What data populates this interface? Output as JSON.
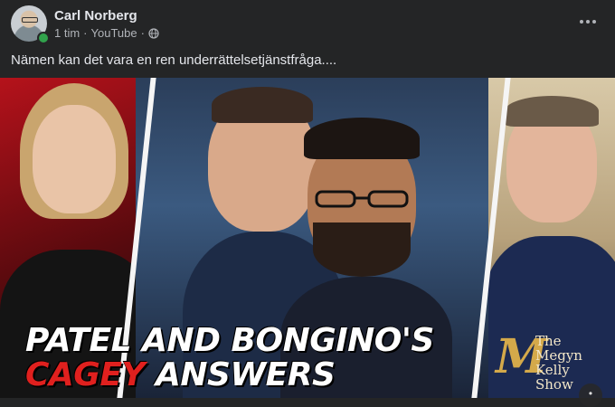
{
  "post": {
    "author": "Carl Norberg",
    "time": "1 tim",
    "separator": "·",
    "source": "YouTube",
    "text": "Nämen kan det vara en ren underrättelsetjänstfråga...."
  },
  "media": {
    "headline_line1": "PATEL AND BONGINO'S",
    "headline_line2_red": "CAGEY",
    "headline_line2_white": "ANSWERS",
    "logo_letter": "M",
    "logo_line1": "The",
    "logo_line2": "Megyn",
    "logo_line3": "Kelly",
    "logo_line4": "Show"
  },
  "icons": {
    "visibility": "globe-icon",
    "menu": "more-horizontal-icon",
    "status": "online-dot"
  },
  "colors": {
    "background": "#242526",
    "accent_red": "#e0201e",
    "online": "#31a24c",
    "logo_gold": "#d4a94a"
  }
}
